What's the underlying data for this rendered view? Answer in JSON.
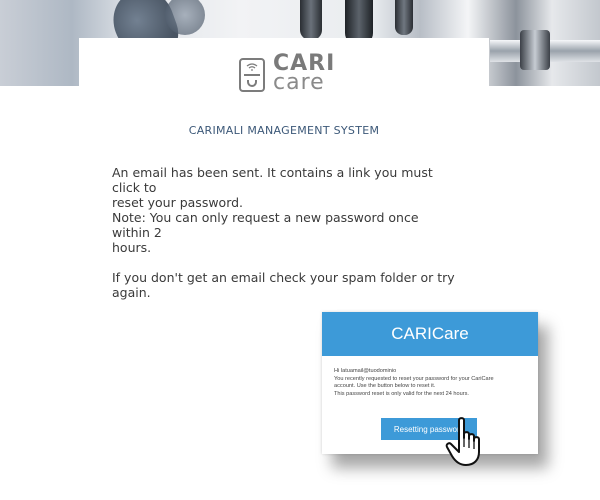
{
  "brand": {
    "logo_line1": "CARI",
    "logo_line2": "care",
    "logo_icon": "coffee-machine-wifi-icon"
  },
  "system_title": "CARIMALI MANAGEMENT SYSTEM",
  "message": {
    "line1": "An email has been sent. It contains a link you must click to",
    "line2": "reset your password.",
    "line3": "Note: You can only request a new password once within 2",
    "line4": "hours.",
    "line5": "If you don't get an email check your spam folder or try",
    "line6": "again."
  },
  "email_preview": {
    "header": "CARICare",
    "greeting": "Hi latuamail@tuodominio",
    "body1": "You recently requested to reset your password for your CariCare",
    "body2": "account. Use the button below to reset it.",
    "body3": "This password reset is only valid for the next 24 hours.",
    "button_label": "Resetting password",
    "accent_color": "#3d9ad8"
  },
  "pointer_icon": "hand-pointer-icon"
}
